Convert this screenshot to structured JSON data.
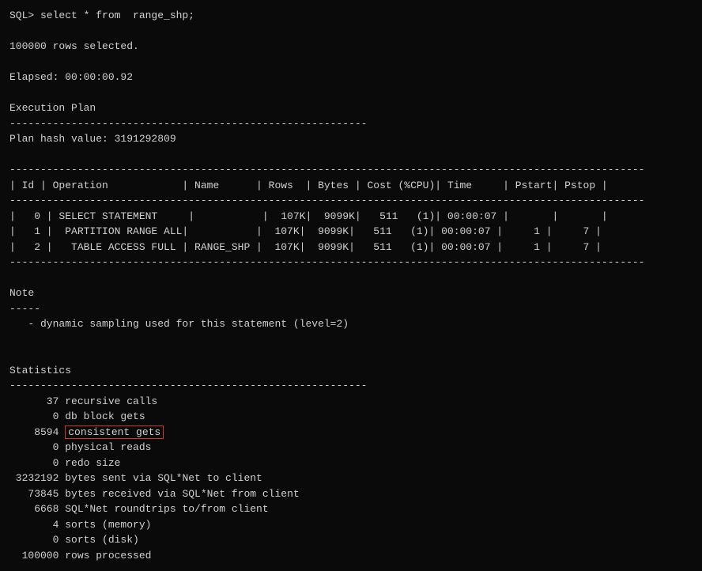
{
  "terminal": {
    "prompt": "SQL> select * from  range_shp;",
    "rows_selected": "100000 rows selected.",
    "elapsed": "Elapsed: 00:00:00.92",
    "execution_plan_header": "Execution Plan",
    "separator_long": "----------------------------------------------------------",
    "plan_hash": "Plan hash value: 3191292809",
    "table_header": "| Id | Operation            | Name      | Rows  | Bytes | Cost (%CPU)| Time     | Pstart| Pstop |",
    "table_sep": "-------------------------------------------------------------------------------------------------------",
    "table_row0": "|   0 | SELECT STATEMENT     |           |  107K|  9099K|   511   (1)| 00:00:07 |       |       |",
    "table_row1": "|   1 |  PARTITION RANGE ALL|           |  107K|  9099K|   511   (1)| 00:00:07 |     1 |     7 |",
    "table_row2": "|   2 |   TABLE ACCESS FULL | RANGE_SHP |  107K|  9099K|   511   (1)| 00:00:07 |     1 |     7 |",
    "note_header": "Note",
    "note_sep": "-----",
    "note_text": "   - dynamic sampling used for this statement (level=2)",
    "statistics_header": "Statistics",
    "stat_sep": "----------------------------------------------------------",
    "stats": [
      {
        "num": "      37",
        "label": "recursive calls"
      },
      {
        "num": "       0",
        "label": "db block gets"
      },
      {
        "num": "    8594",
        "label": "consistent gets",
        "highlight": true
      },
      {
        "num": "       0",
        "label": "physical reads"
      },
      {
        "num": "       0",
        "label": "redo size"
      },
      {
        "num": " 3232192",
        "label": "bytes sent via SQL*Net to client"
      },
      {
        "num": "   73845",
        "label": "bytes received via SQL*Net from client"
      },
      {
        "num": "    6668",
        "label": "SQL*Net roundtrips to/from client"
      },
      {
        "num": "       4",
        "label": "sorts (memory)"
      },
      {
        "num": "       0",
        "label": "sorts (disk)"
      },
      {
        "num": "  100000",
        "label": "rows processed"
      }
    ]
  }
}
